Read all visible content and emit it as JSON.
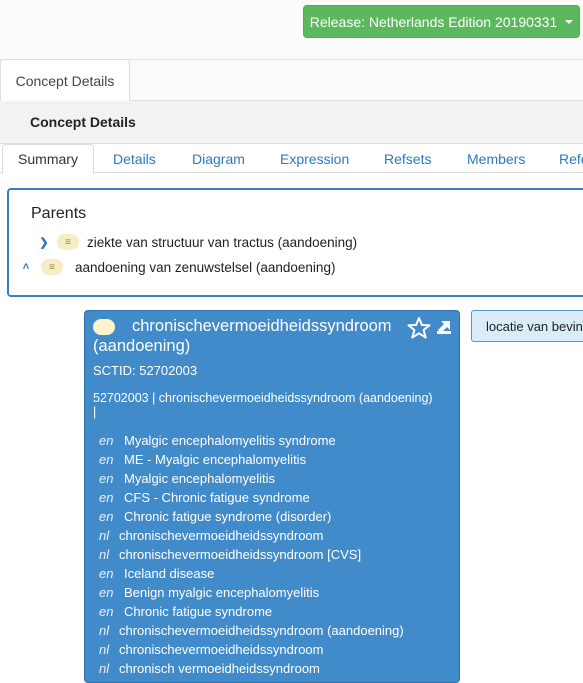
{
  "release": {
    "label": "Release: Netherlands Edition 20190331"
  },
  "outer_tab": {
    "label": "Concept Details"
  },
  "panel": {
    "heading": "Concept Details"
  },
  "inner_tabs": [
    "Summary",
    "Details",
    "Diagram",
    "Expression",
    "Refsets",
    "Members",
    "Refe"
  ],
  "parents": {
    "title": "Parents",
    "items": [
      {
        "label": "ziekte van structuur van tractus (aandoening)",
        "icon": "chevron-right-icon"
      },
      {
        "label": "aandoening van zenuwstelsel (aandoening)",
        "icon": "chevron-up-icon"
      }
    ],
    "pill_glyph": "≡"
  },
  "concept": {
    "title": "chronischevermoeidheidssyndroom (aandoening)",
    "sctid": "SCTID: 52702003",
    "fsn": "52702003 | chronischevermoeidheidssyndroom (aandoening) |",
    "descriptions": [
      {
        "lang": "en",
        "text": "Myalgic encephalomyelitis syndrome"
      },
      {
        "lang": "en",
        "text": "ME - Myalgic encephalomyelitis"
      },
      {
        "lang": "en",
        "text": "Myalgic encephalomyelitis"
      },
      {
        "lang": "en",
        "text": "CFS - Chronic fatigue syndrome"
      },
      {
        "lang": "en",
        "text": "Chronic fatigue syndrome (disorder)"
      },
      {
        "lang": "nl",
        "text": "chronischevermoeidheidssyndroom"
      },
      {
        "lang": "nl",
        "text": "chronischevermoeidheidssyndroom [CVS]"
      },
      {
        "lang": "en",
        "text": "Iceland disease"
      },
      {
        "lang": "en",
        "text": "Benign myalgic encephalomyelitis"
      },
      {
        "lang": "en",
        "text": "Chronic fatigue syndrome"
      },
      {
        "lang": "nl",
        "text": "chronischevermoeidheidssyndroom (aandoening)"
      },
      {
        "lang": "nl",
        "text": "chronischevermoeidheidssyndroom"
      },
      {
        "lang": "nl",
        "text": "chronisch vermoeidheidssyndroom"
      }
    ]
  },
  "attribute": {
    "label": "locatie van bevinding"
  },
  "colors": {
    "primary": "#428bca",
    "success": "#5cb85c",
    "link": "#2a7ac0"
  }
}
